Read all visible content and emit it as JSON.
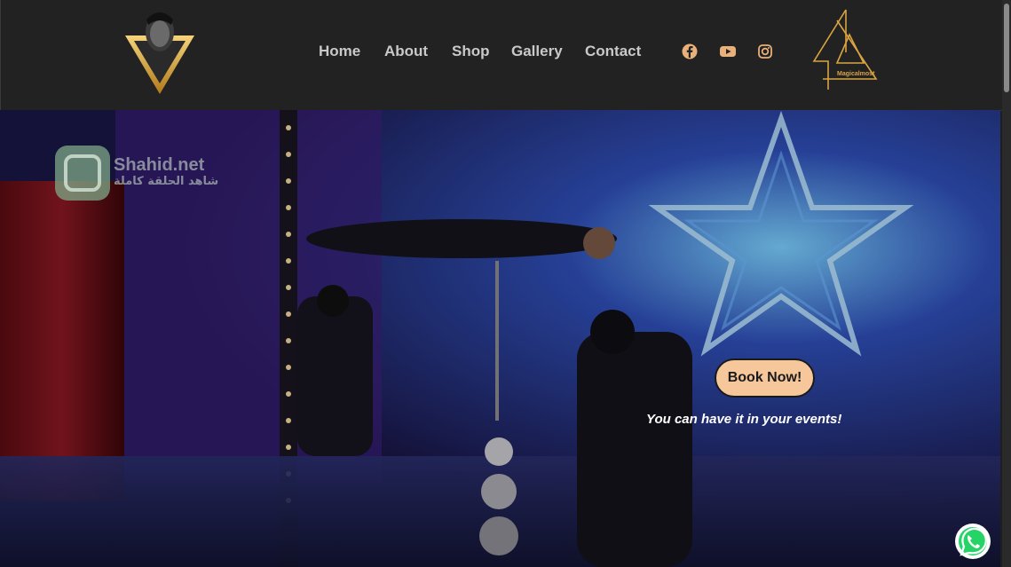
{
  "header": {
    "nav": [
      {
        "label": "Home"
      },
      {
        "label": "About"
      },
      {
        "label": "Shop"
      },
      {
        "label": "Gallery"
      },
      {
        "label": "Contact"
      }
    ],
    "social_icons": [
      "facebook-icon",
      "youtube-icon",
      "instagram-icon"
    ],
    "right_logo_text": "Magicalmost"
  },
  "hero": {
    "watermark_title": "Shahid.net",
    "watermark_subtitle": "شاهد الحلقة كاملة",
    "cta_label": "Book Now!",
    "tagline": "You can have it in your events!"
  },
  "colors": {
    "header_bg": "#222222",
    "nav_text": "#c9c9c9",
    "accent_gold": "#d9a441",
    "cta_bg": "#f6c79a"
  }
}
